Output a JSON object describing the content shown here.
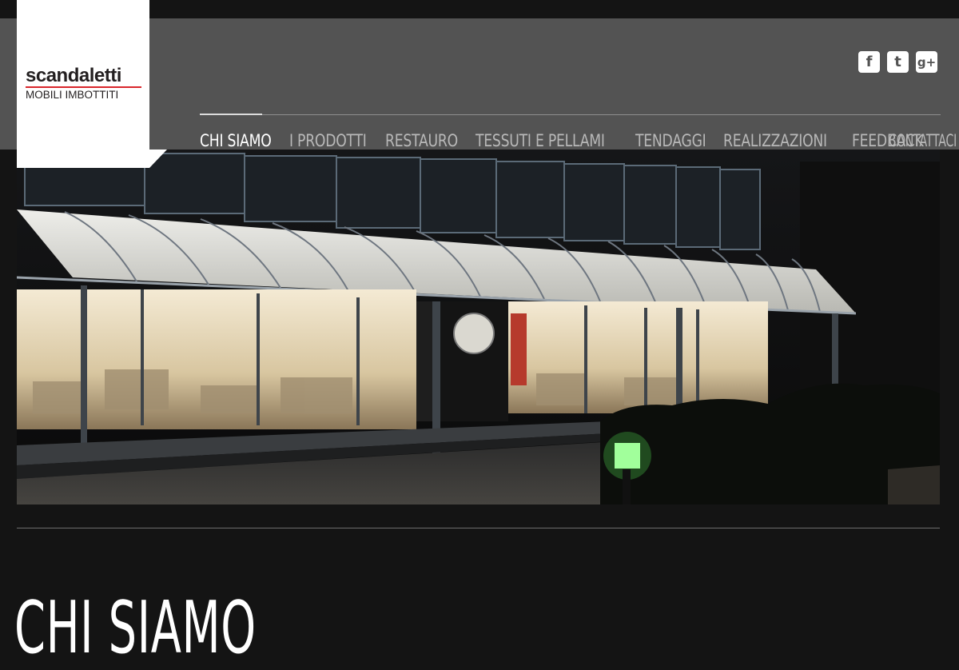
{
  "brand": {
    "name": "scandaletti",
    "tagline": "MOBILI IMBOTTITI",
    "accent_color": "#d9262b"
  },
  "social": [
    {
      "icon": "facebook-icon",
      "glyph": "f"
    },
    {
      "icon": "twitter-icon",
      "glyph": "t"
    },
    {
      "icon": "google-plus-icon",
      "glyph": "g+"
    }
  ],
  "nav": {
    "items": [
      {
        "label": "CHI SIAMO",
        "active": true
      },
      {
        "label": "I PRODOTTI",
        "active": false
      },
      {
        "label": "RESTAURO",
        "active": false
      },
      {
        "label": "TESSUTI E PELLAMI",
        "active": false
      },
      {
        "label": "TENDAGGI",
        "active": false
      },
      {
        "label": "REALIZZAZIONI",
        "active": false
      },
      {
        "label": "FEEDBACK",
        "active": false
      },
      {
        "label": "CONTATTACI",
        "active": false
      }
    ]
  },
  "page": {
    "title": "CHI SIAMO"
  },
  "colors": {
    "header_bg": "#535353",
    "page_bg": "#141414",
    "nav_text": "#b8b8b8",
    "nav_active": "#ffffff"
  }
}
